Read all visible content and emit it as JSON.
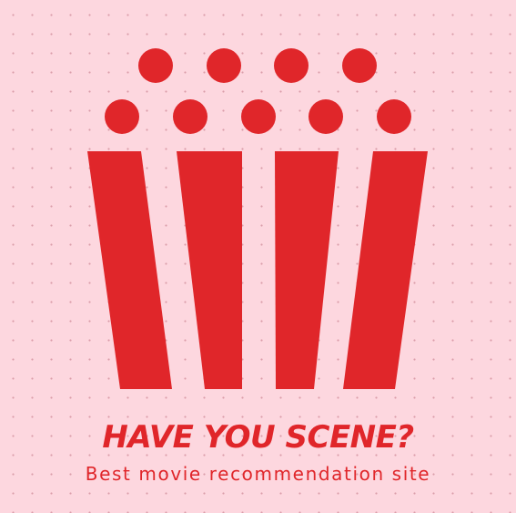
{
  "brand": {
    "title": "HAVE YOU SCENE?",
    "tagline": "Best movie recommendation site",
    "logo_icon": "popcorn-box-icon",
    "accent_color": "#e0262a",
    "background_color": "#fdd7df"
  }
}
